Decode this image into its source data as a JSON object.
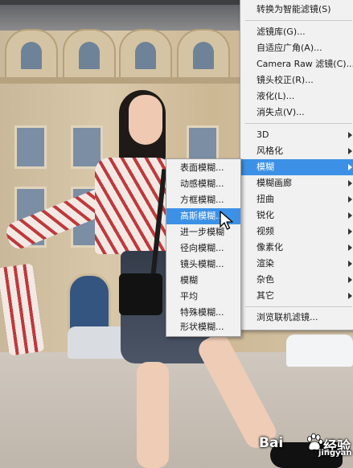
{
  "main_menu": {
    "items": [
      {
        "label": "转换为智能滤镜(S)"
      },
      {
        "label": "滤镜库(G)..."
      },
      {
        "label": "自适应广角(A)..."
      },
      {
        "label": "Camera Raw 滤镜(C)..."
      },
      {
        "label": "镜头校正(R)..."
      },
      {
        "label": "液化(L)..."
      },
      {
        "label": "消失点(V)..."
      },
      {
        "label": "3D"
      },
      {
        "label": "风格化"
      },
      {
        "label": "模糊"
      },
      {
        "label": "模糊画廊"
      },
      {
        "label": "扭曲"
      },
      {
        "label": "锐化"
      },
      {
        "label": "视频"
      },
      {
        "label": "像素化"
      },
      {
        "label": "渲染"
      },
      {
        "label": "杂色"
      },
      {
        "label": "其它"
      },
      {
        "label": "浏览联机滤镜..."
      }
    ],
    "highlighted": "模糊"
  },
  "blur_submenu": {
    "items": [
      {
        "label": "表面模糊..."
      },
      {
        "label": "动感模糊..."
      },
      {
        "label": "方框模糊..."
      },
      {
        "label": "高斯模糊..."
      },
      {
        "label": "进一步模糊"
      },
      {
        "label": "径向模糊..."
      },
      {
        "label": "镜头模糊..."
      },
      {
        "label": "模糊"
      },
      {
        "label": "平均"
      },
      {
        "label": "特殊模糊..."
      },
      {
        "label": "形状模糊..."
      }
    ],
    "highlighted": "高斯模糊..."
  },
  "watermark": {
    "brand_left": "Bai",
    "brand_right": "经验",
    "brand_sub": "jingyan"
  },
  "colors": {
    "menu_bg": "#f1f1f1",
    "highlight": "#3c91e6"
  }
}
